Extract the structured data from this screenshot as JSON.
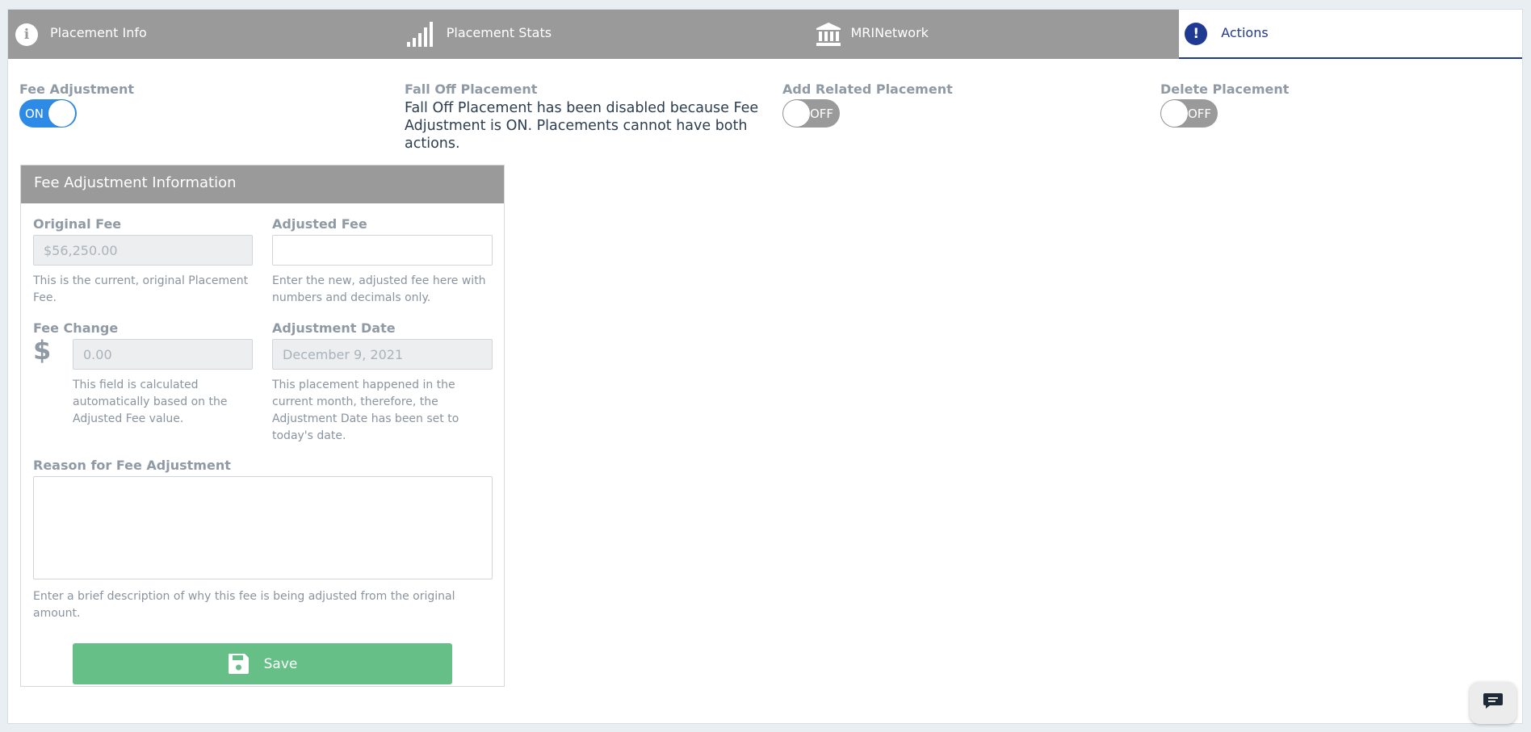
{
  "tabs": [
    {
      "label": "Placement Info",
      "icon": "info-icon"
    },
    {
      "label": "Placement Stats",
      "icon": "signal-bars-icon"
    },
    {
      "label": "MRINetwork",
      "icon": "bank-icon"
    },
    {
      "label": "Actions",
      "icon": "exclamation-icon"
    }
  ],
  "actions": {
    "fee_adjustment": {
      "label": "Fee Adjustment",
      "toggle": "ON"
    },
    "fall_off": {
      "label": "Fall Off Placement",
      "message": "Fall Off Placement has been disabled because Fee Adjustment is ON. Placements cannot have both actions."
    },
    "add_related": {
      "label": "Add Related Placement",
      "toggle": "OFF"
    },
    "delete": {
      "label": "Delete Placement",
      "toggle": "OFF"
    }
  },
  "panel": {
    "title": "Fee Adjustment Information",
    "original_fee": {
      "label": "Original Fee",
      "value": "$56,250.00",
      "help": "This is the current, original Placement Fee."
    },
    "adjusted_fee": {
      "label": "Adjusted Fee",
      "value": "",
      "help": "Enter the new, adjusted fee here with numbers and decimals only."
    },
    "fee_change": {
      "label": "Fee Change",
      "currency": "$",
      "value": "0.00",
      "help": "This field is calculated automatically based on the Adjusted Fee value."
    },
    "adjustment_date": {
      "label": "Adjustment Date",
      "value": "December 9, 2021",
      "help": "This placement happened in the current month, therefore, the Adjustment Date has been set to today's date."
    },
    "reason": {
      "label": "Reason for Fee Adjustment",
      "value": "",
      "help": "Enter a brief description of why this fee is being adjusted from the original amount."
    },
    "save_label": "Save"
  },
  "colors": {
    "tab_bg": "#9a9a9a",
    "active_tab": "#1f3a93",
    "toggle_on": "#2d8ae6",
    "toggle_off": "#9a9a9a",
    "save_button": "#65bf86"
  }
}
